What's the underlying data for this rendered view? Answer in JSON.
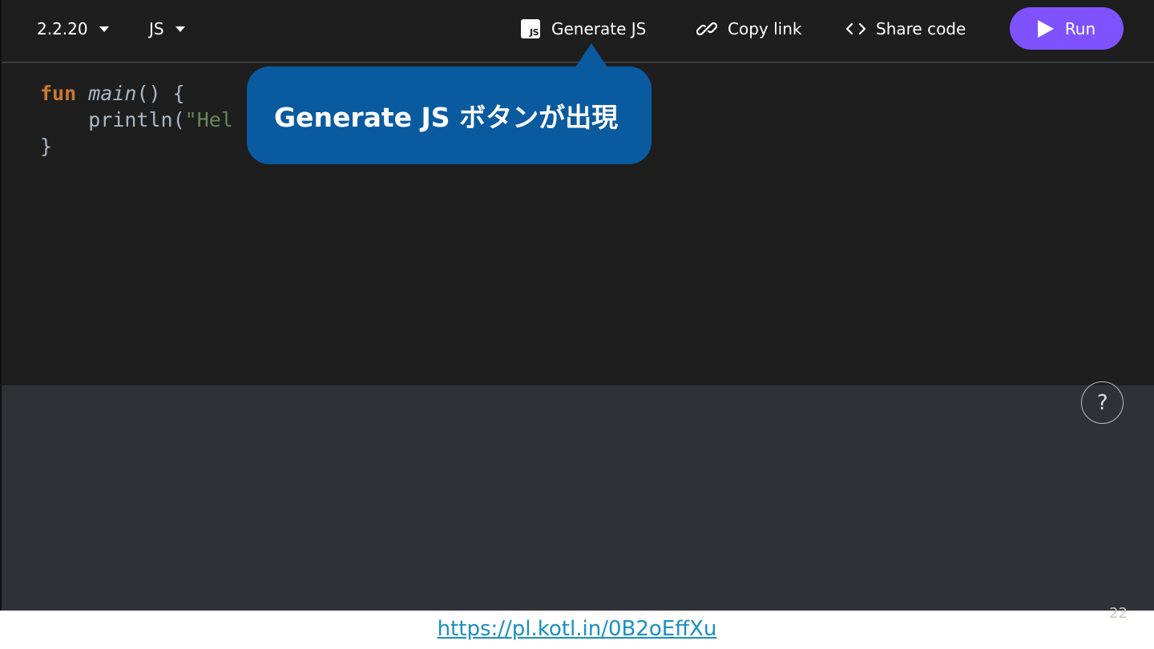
{
  "toolbar": {
    "version_label": "2.2.20",
    "target_label": "JS",
    "generate_js_label": "Generate JS",
    "js_badge_text": "JS",
    "copy_link_label": "Copy link",
    "share_code_label": "Share code",
    "run_label": "Run"
  },
  "editor": {
    "line1": {
      "keyword": "fun",
      "name": "main",
      "rest": "() {"
    },
    "line2": {
      "indent": "    ",
      "call": "println(",
      "string": "\"Hel"
    },
    "line3": "}"
  },
  "help_label": "?",
  "callout": {
    "text": "Generate JS ボタンが出現"
  },
  "footer": {
    "link": "https://pl.kotl.in/0B2oEffXu",
    "page_number": "22"
  },
  "colors": {
    "accent": "#7f52ff",
    "callout": "#0a5aa0",
    "editor_bg": "#1e1e1e",
    "output_bg": "#303136",
    "link": "#1a8fbf"
  }
}
